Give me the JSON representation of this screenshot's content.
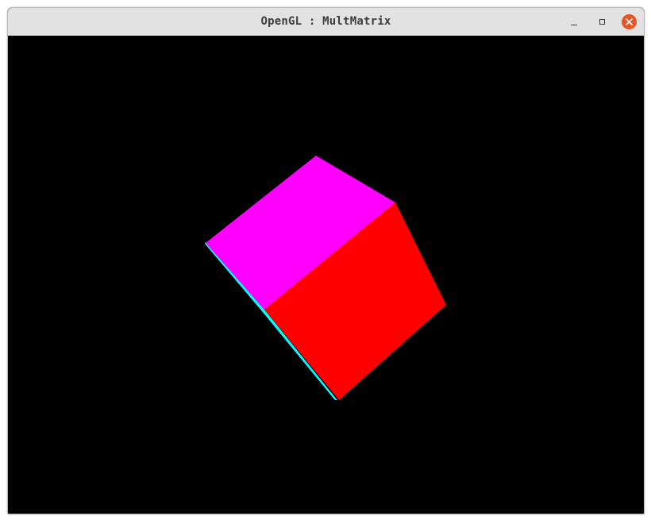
{
  "window": {
    "title": "OpenGL : MultMatrix"
  },
  "titlebar_buttons": {
    "minimize_icon": "minimize-icon",
    "maximize_icon": "maximize-icon",
    "close_icon": "close-icon"
  },
  "scene": {
    "background_color": "#000000",
    "faces": [
      {
        "name": "cube-face-top",
        "color": "#ff00ff"
      },
      {
        "name": "cube-face-front",
        "color": "#ff0000"
      },
      {
        "name": "cube-face-side-edge",
        "color": "#00ffff"
      }
    ]
  },
  "colors": {
    "titlebar": "#e2e2e2",
    "close_button": "#e95420"
  }
}
